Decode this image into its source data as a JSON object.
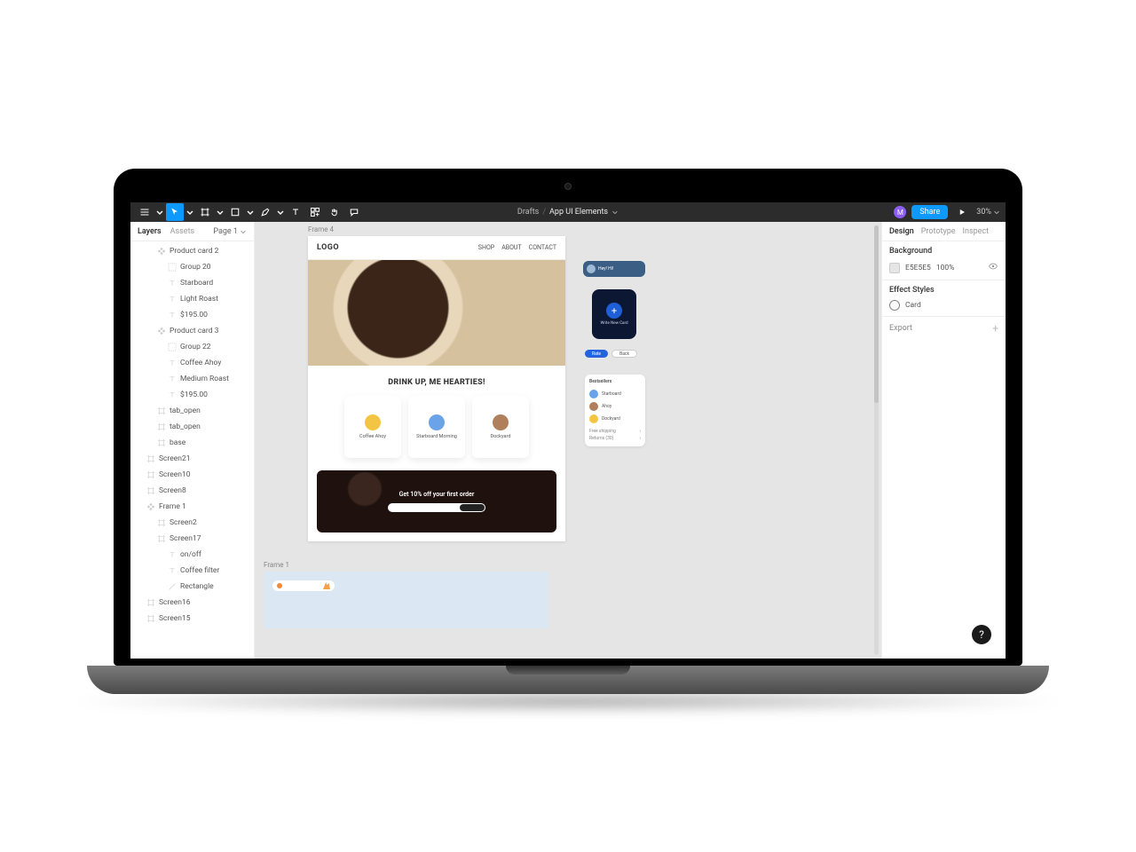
{
  "toolbar": {
    "breadcrumb_root": "Drafts",
    "breadcrumb_doc": "App UI Elements",
    "avatar_initial": "M",
    "share_label": "Share",
    "zoom": "30%"
  },
  "left_panel": {
    "tab_layers": "Layers",
    "tab_assets": "Assets",
    "page_label": "Page 1"
  },
  "layers": [
    {
      "depth": 2,
      "icon": "component",
      "label": "Product card 2"
    },
    {
      "depth": 3,
      "icon": "group",
      "label": "Group 20"
    },
    {
      "depth": 3,
      "icon": "text",
      "label": "Starboard"
    },
    {
      "depth": 3,
      "icon": "text",
      "label": "Light Roast"
    },
    {
      "depth": 3,
      "icon": "text",
      "label": "$195.00"
    },
    {
      "depth": 2,
      "icon": "component",
      "label": "Product card 3"
    },
    {
      "depth": 3,
      "icon": "group",
      "label": "Group 22"
    },
    {
      "depth": 3,
      "icon": "text",
      "label": "Coffee Ahoy"
    },
    {
      "depth": 3,
      "icon": "text",
      "label": "Medium Roast"
    },
    {
      "depth": 3,
      "icon": "text",
      "label": "$195.00"
    },
    {
      "depth": 2,
      "icon": "frame",
      "label": "tab_open"
    },
    {
      "depth": 2,
      "icon": "frame",
      "label": "tab_open"
    },
    {
      "depth": 2,
      "icon": "frame",
      "label": "base"
    },
    {
      "depth": 1,
      "icon": "frame",
      "label": "Screen21"
    },
    {
      "depth": 1,
      "icon": "frame",
      "label": "Screen10"
    },
    {
      "depth": 1,
      "icon": "frame",
      "label": "Screen8"
    },
    {
      "depth": 1,
      "icon": "component",
      "label": "Frame 1"
    },
    {
      "depth": 2,
      "icon": "frame",
      "label": "Screen2"
    },
    {
      "depth": 2,
      "icon": "frame",
      "label": "Screen17"
    },
    {
      "depth": 3,
      "icon": "text",
      "label": "on/off"
    },
    {
      "depth": 3,
      "icon": "text",
      "label": "Coffee filter"
    },
    {
      "depth": 3,
      "icon": "line",
      "label": "Rectangle"
    },
    {
      "depth": 1,
      "icon": "frame",
      "label": "Screen16"
    },
    {
      "depth": 1,
      "icon": "frame",
      "label": "Screen15"
    }
  ],
  "right_panel": {
    "tab_design": "Design",
    "tab_prototype": "Prototype",
    "tab_inspect": "Inspect",
    "background_label": "Background",
    "background_hex": "E5E5E5",
    "background_opacity": "100%",
    "effect_styles_label": "Effect Styles",
    "effect_style_name": "Card",
    "export_label": "Export"
  },
  "canvas": {
    "frame4": {
      "label": "Frame 4",
      "logo": "LOGO",
      "nav": [
        "SHOP",
        "ABOUT",
        "CONTACT"
      ],
      "tagline": "DRINK UP, ME HEARTIES!",
      "cards": [
        {
          "caption": "Coffee Ahoy",
          "dot": "#f4c542"
        },
        {
          "caption": "Starboard Morning",
          "dot": "#6aa3e8"
        },
        {
          "caption": "Dockyard",
          "dot": "#b0805c"
        }
      ],
      "promo_text": "Get 10% off your first order"
    },
    "frame1_label": "Frame 1",
    "sideA_text": "Hey! Hi!",
    "sideB_text": "Write New Card",
    "sideC": {
      "primary": "Rate",
      "secondary": "Back"
    },
    "sideD": {
      "heading": "Bestsellers",
      "rows": [
        {
          "color": "#6aa3e8",
          "label": "Starboard"
        },
        {
          "color": "#b0805c",
          "label": "Ahoy"
        },
        {
          "color": "#f4c542",
          "label": "Dockyard"
        }
      ],
      "meta": [
        {
          "k": "Free shipping",
          "v": "‹"
        },
        {
          "k": "Returns (30)",
          "v": "‹"
        }
      ]
    }
  }
}
